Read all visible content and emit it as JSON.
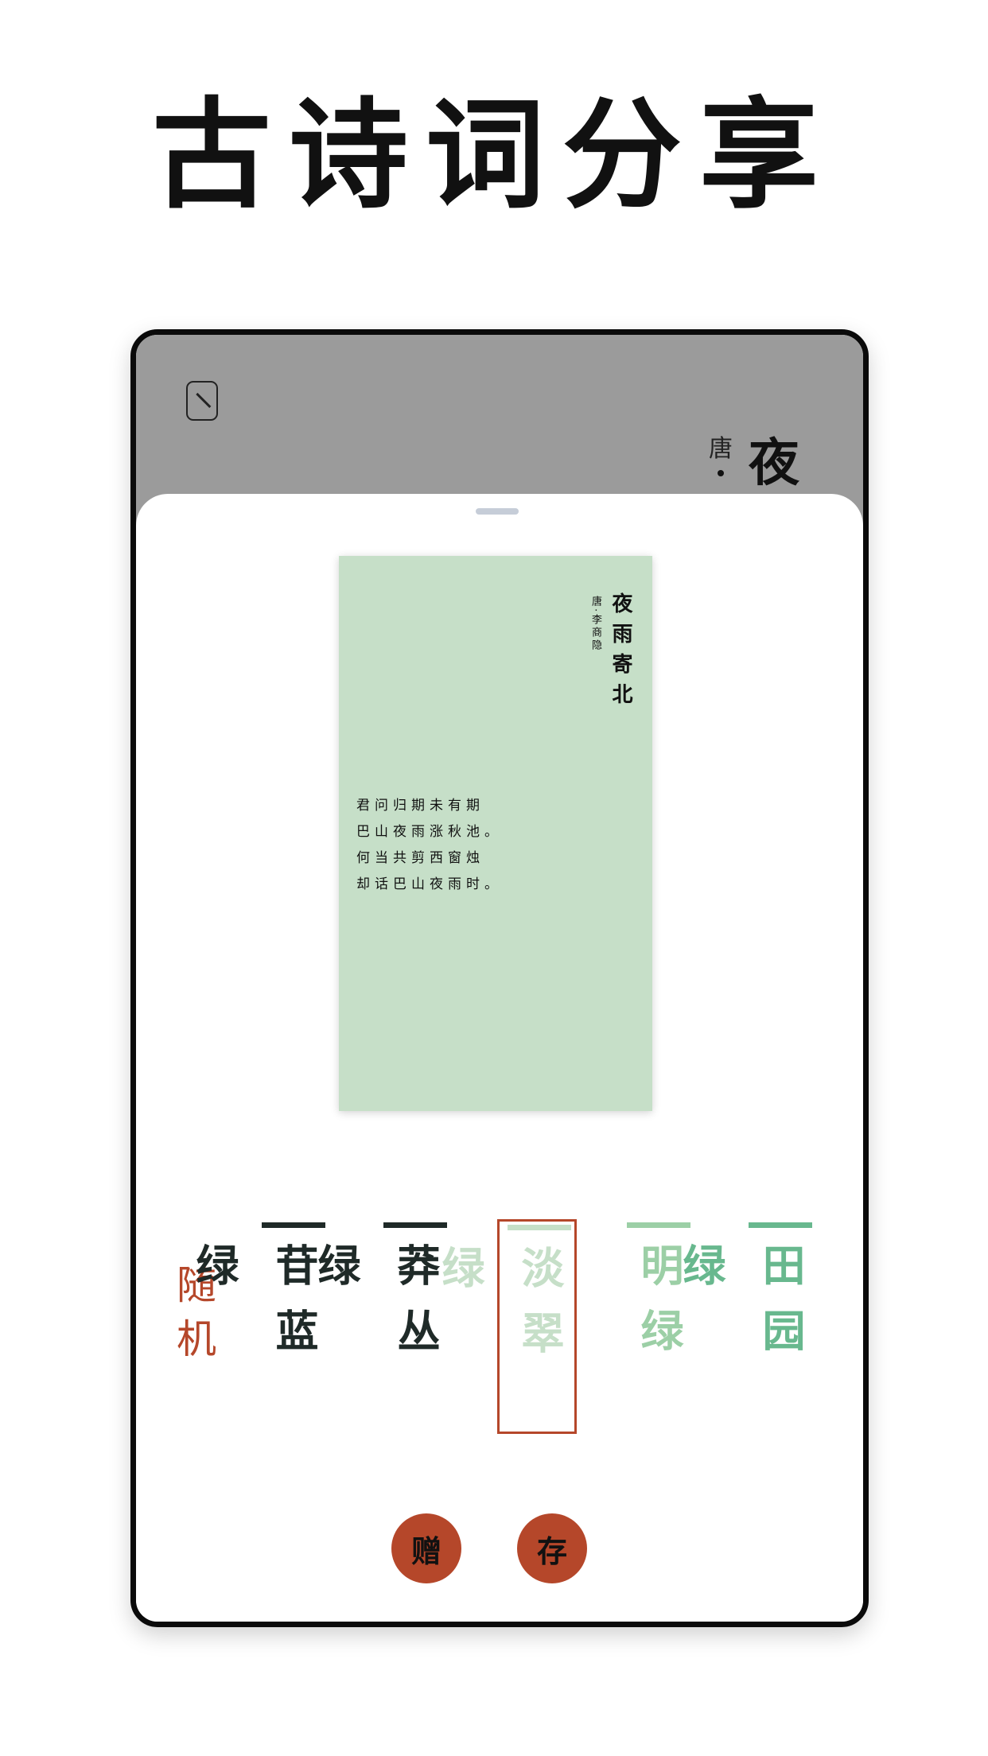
{
  "hero": {
    "title": "古诗词分享"
  },
  "background_page": {
    "dynasty": "唐",
    "title_char": "夜"
  },
  "card": {
    "bg_color": "#c6dfc8",
    "title": "夜雨寄北",
    "author": "唐·李商隐",
    "lines": [
      "君问归期未有期",
      "巴山夜雨涨秋池。",
      "何当共剪西窗烛",
      "却话巴山夜雨时。"
    ]
  },
  "controls": {
    "random_label": "随机",
    "colors": [
      {
        "name": "苷蓝绿",
        "bar": "#1f2a28",
        "text": "#1f2a28",
        "selected": false
      },
      {
        "name": "莽丛绿",
        "bar": "#1f2a28",
        "text": "#1f2a28",
        "selected": false
      },
      {
        "name": "淡翠绿",
        "bar": "#c6dfc8",
        "text": "#c6dfc8",
        "selected": true
      },
      {
        "name": "明绿",
        "bar": "#9ccfa6",
        "text": "#9ccfa6",
        "selected": false
      },
      {
        "name": "田园绿",
        "bar": "#68b88e",
        "text": "#68b88e",
        "selected": false
      }
    ],
    "gift_label": "赠",
    "save_label": "存"
  },
  "colors": {
    "accent": "#b5472a",
    "top_bar": "#9b9b9b"
  }
}
